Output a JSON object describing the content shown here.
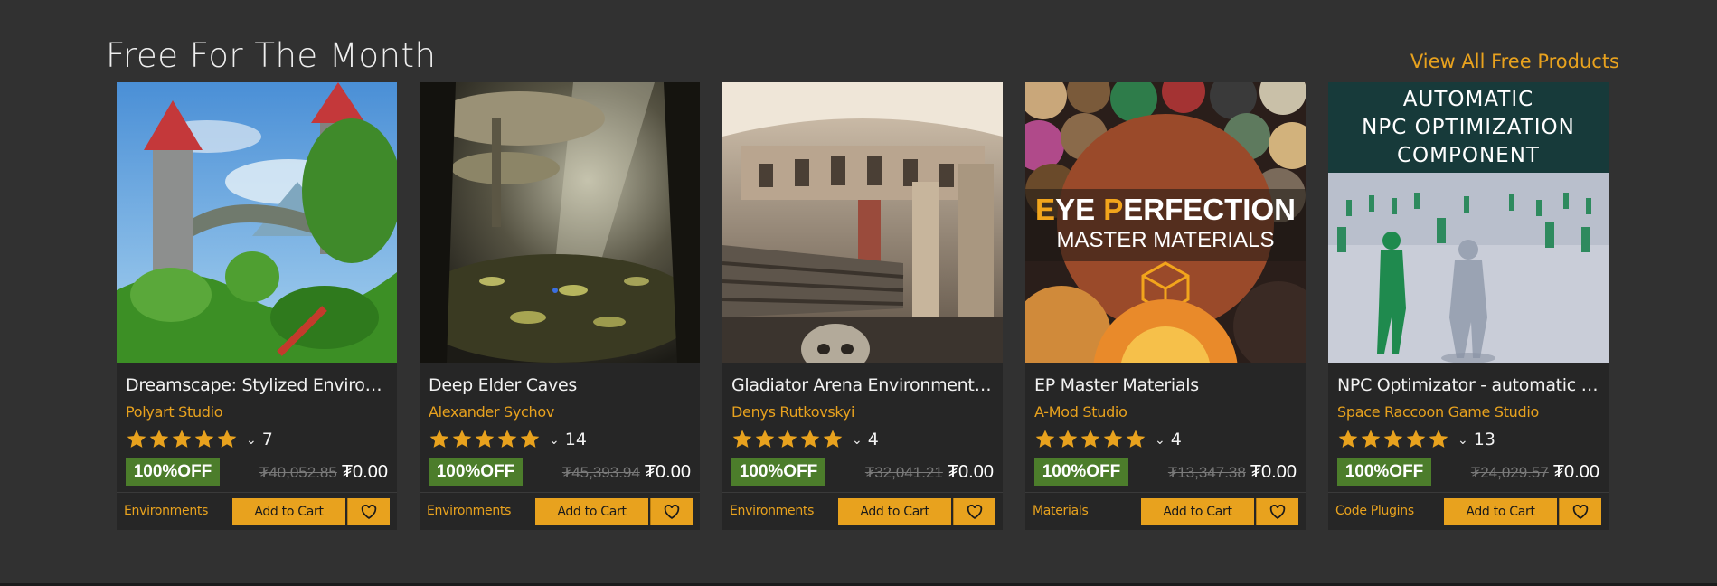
{
  "section": {
    "title": "Free For The Month",
    "view_all": "View All Free Products"
  },
  "colors": {
    "accent": "#e8a21e",
    "badge": "#4c7d2b",
    "card": "#262626",
    "background": "#313131"
  },
  "products": [
    {
      "title": "Dreamscape: Stylized Environme...",
      "seller": "Polyart Studio",
      "rating": 5,
      "reviews": "7",
      "discount": "100%OFF",
      "old_price": "₮40,052.85",
      "new_price": "₮0.00",
      "category": "Environments",
      "cart_label": "Add to Cart"
    },
    {
      "title": "Deep Elder Caves",
      "seller": "Alexander Sychov",
      "rating": 5,
      "reviews": "14",
      "discount": "100%OFF",
      "old_price": "₮45,393.94",
      "new_price": "₮0.00",
      "category": "Environments",
      "cart_label": "Add to Cart"
    },
    {
      "title": "Gladiator Arena Environment Kit",
      "seller": "Denys Rutkovskyi",
      "rating": 5,
      "reviews": "4",
      "discount": "100%OFF",
      "old_price": "₮32,041.21",
      "new_price": "₮0.00",
      "category": "Environments",
      "cart_label": "Add to Cart"
    },
    {
      "title": "EP Master Materials",
      "seller": "A-Mod Studio",
      "rating": 5,
      "reviews": "4",
      "discount": "100%OFF",
      "old_price": "₮13,347.38",
      "new_price": "₮0.00",
      "category": "Materials",
      "cart_label": "Add to Cart",
      "image_text": {
        "line1_e": "E",
        "line1_ye": "YE ",
        "line1_p": "P",
        "line1_rest": "ERFECTION",
        "line2": "MASTER MATERIALS"
      }
    },
    {
      "title": "NPC Optimizator - automatic opti...",
      "seller": "Space Raccoon Game Studio",
      "rating": 5,
      "reviews": "13",
      "discount": "100%OFF",
      "old_price": "₮24,029.57",
      "new_price": "₮0.00",
      "category": "Code Plugins",
      "cart_label": "Add to Cart",
      "image_text": {
        "line1": "AUTOMATIC",
        "line2": "NPC OPTIMIZATION",
        "line3": "COMPONENT"
      }
    }
  ]
}
